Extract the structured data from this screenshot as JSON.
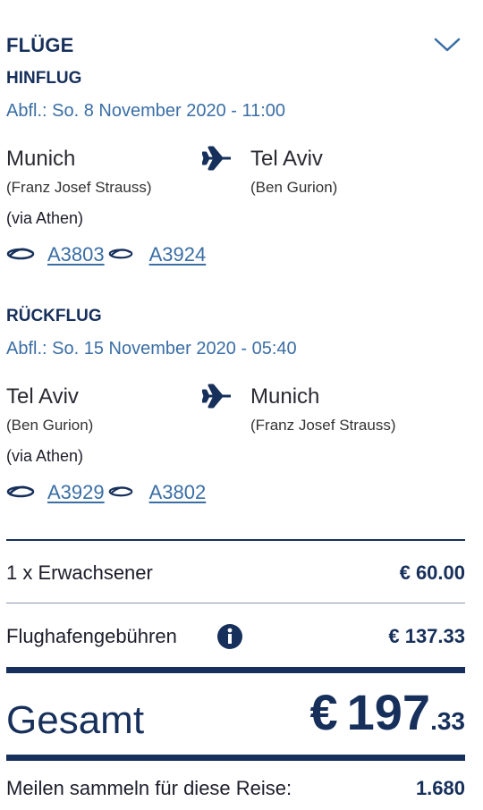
{
  "header": {
    "title": "FLÜGE",
    "toggle_icon": "chevron-down-icon"
  },
  "outbound": {
    "heading": "HINFLUG",
    "departure": "Abfl.: So. 8 November 2020 - 11:00",
    "from_city": "Munich",
    "from_airport": "(Franz Josef Strauss)",
    "to_city": "Tel Aviv",
    "to_airport": "(Ben Gurion)",
    "via": "(via Athen)",
    "flights": [
      "A3803",
      "A3924"
    ]
  },
  "inbound": {
    "heading": "RÜCKFLUG",
    "departure": "Abfl.: So. 15 November 2020 - 05:40",
    "from_city": "Tel Aviv",
    "from_airport": "(Ben Gurion)",
    "to_city": "Munich",
    "to_airport": "(Franz Josef Strauss)",
    "via": "(via Athen)",
    "flights": [
      "A3929",
      "A3802"
    ]
  },
  "pricing": {
    "adult_label": "1 x Erwachsener",
    "adult_price": "€ 60.00",
    "fees_label": "Flughafengebühren",
    "fees_price": "€ 137.33",
    "total_label": "Gesamt",
    "total_currency": "€",
    "total_main": "197",
    "total_cents": ".33",
    "miles_label": "Meilen sammeln für diese Reise:",
    "miles_value": "1.680"
  },
  "colors": {
    "navy": "#17305b",
    "link_blue": "#3a6ea5"
  }
}
